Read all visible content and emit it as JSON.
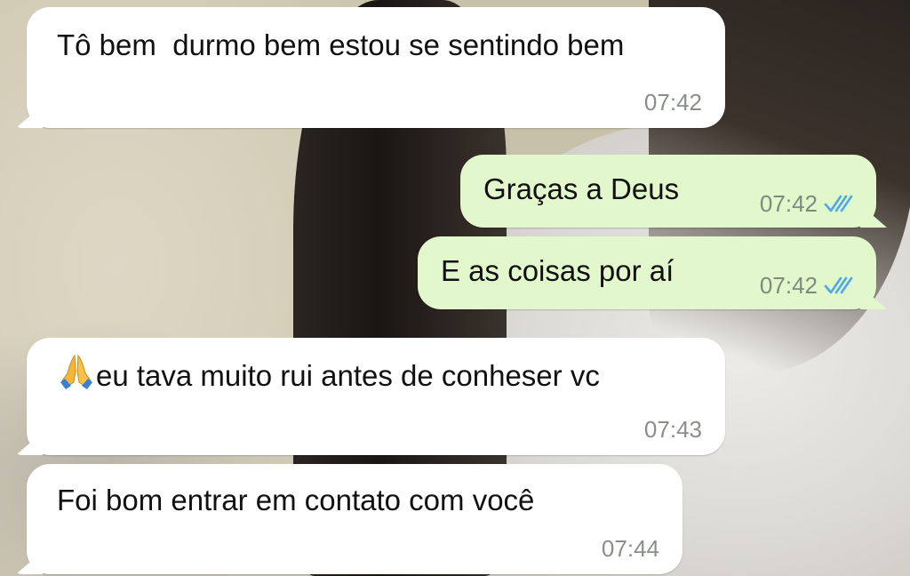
{
  "chat": {
    "messages": [
      {
        "direction": "incoming",
        "text": "Tô bem  durmo bem estou se sentindo bem",
        "time": "07:42"
      },
      {
        "direction": "outgoing",
        "text": "Graças a Deus",
        "time": "07:42",
        "status": "read",
        "status_icon": "double-check-icon"
      },
      {
        "direction": "outgoing",
        "text": "E as coisas por aí",
        "time": "07:42",
        "status": "read",
        "status_icon": "double-check-icon"
      },
      {
        "direction": "incoming",
        "emoji": "🙏",
        "emoji_icon": "praying-hands-emoji",
        "text": "eu tava muito rui antes de conheser vc",
        "time": "07:43"
      },
      {
        "direction": "incoming",
        "text": "Foi bom entrar em contato com você",
        "time": "07:44"
      }
    ]
  },
  "colors": {
    "incoming_bubble": "#ffffff",
    "outgoing_bubble": "#e2f7cb",
    "read_check": "#4fa8e8",
    "timestamp": "#8a8f8a"
  }
}
